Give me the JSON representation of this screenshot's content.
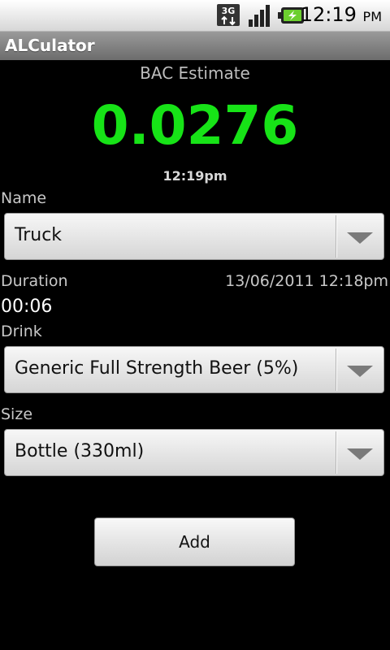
{
  "status_bar": {
    "network": "3G",
    "time": "12:19",
    "ampm": "PM",
    "icons": [
      "3g-data-icon",
      "signal-icon",
      "battery-charging-icon"
    ]
  },
  "app": {
    "title": "ALCulator"
  },
  "bac": {
    "label": "BAC Estimate",
    "value": "0.0276",
    "time": "12:19pm",
    "color": "#17e317"
  },
  "name": {
    "label": "Name",
    "selected": "Truck"
  },
  "duration": {
    "label": "Duration",
    "value": "00:06",
    "datetime": "13/06/2011 12:18pm"
  },
  "drink": {
    "label": "Drink",
    "selected": "Generic Full Strength Beer (5%)"
  },
  "size": {
    "label": "Size",
    "selected": "Bottle (330ml)"
  },
  "actions": {
    "add_label": "Add"
  }
}
